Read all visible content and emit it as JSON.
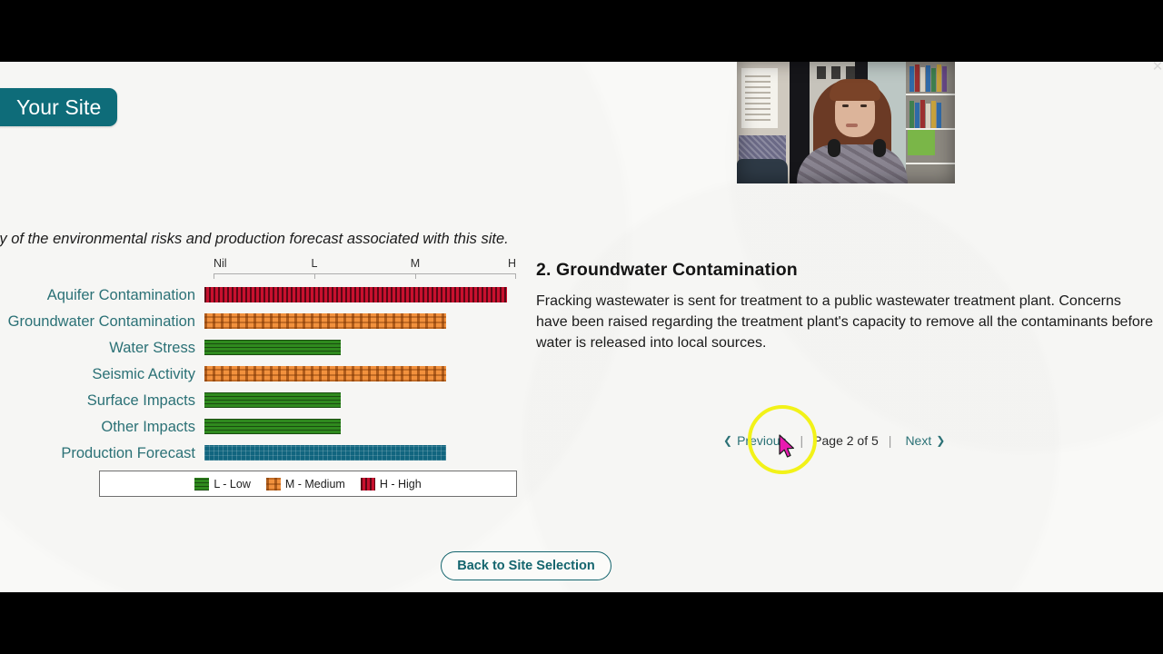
{
  "site_tab": {
    "label": "Your Site"
  },
  "intro": {
    "text": "Below is a summary of the environmental risks and production forecast associated with this site."
  },
  "chart_data": {
    "type": "bar",
    "orientation": "horizontal",
    "title": "",
    "xlabel": "",
    "ylabel": "",
    "grid": false,
    "legend_position": "bottom",
    "axis_tick_labels": [
      "Nil",
      "L",
      "M",
      "H"
    ],
    "axis_tick_values": [
      0,
      1,
      2,
      3
    ],
    "xlim": [
      0,
      3
    ],
    "categories": [
      "Aquifer Contamination",
      "Groundwater Contamination",
      "Water Stress",
      "Seismic Activity",
      "Surface Impacts",
      "Other Impacts",
      "Production Forecast"
    ],
    "values": [
      3.0,
      2.4,
      1.35,
      2.4,
      1.35,
      1.35,
      2.4
    ],
    "ratings": [
      "High",
      "Medium",
      "Low",
      "Medium",
      "Low",
      "Low",
      "Medium"
    ],
    "bar_styles": [
      "high",
      "medium",
      "low",
      "medium",
      "low",
      "low",
      "forecast"
    ],
    "colors": {
      "low": "#2f8a1e",
      "medium": "#f2913d",
      "high": "#c8102e",
      "forecast": "#11657f",
      "label": "#2b7176"
    }
  },
  "legend": {
    "items": [
      {
        "key": "low",
        "label": "L - Low"
      },
      {
        "key": "medium",
        "label": "M - Medium"
      },
      {
        "key": "high",
        "label": "H - High"
      }
    ]
  },
  "detail": {
    "heading": "2. Groundwater Contamination",
    "body": "Fracking wastewater is sent for treatment to a public wastewater treatment plant. Concerns have been raised regarding the treatment plant's capacity to remove all the contaminants before water is released into local sources."
  },
  "pager": {
    "previous_label": "Previous",
    "previous_chevron": "❮",
    "next_label": "Next",
    "next_chevron": "❯",
    "page_indicator": "Page 2 of 5",
    "separator": "|"
  },
  "back_button": {
    "label": "Back to Site Selection"
  },
  "close_button": {
    "glyph": "✕"
  },
  "webcam": {
    "alt": "presenter-video-overlay"
  }
}
